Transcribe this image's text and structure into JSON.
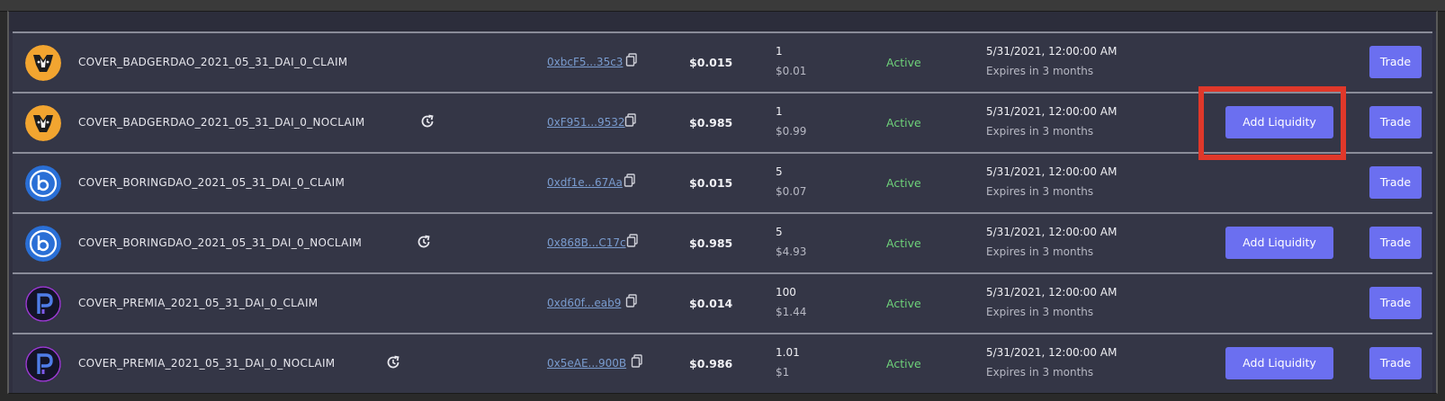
{
  "colors": {
    "accent_button": "#6b6ff0",
    "status_active": "#6ed17a",
    "highlight_box": "#e0382a",
    "row_bg": "#343646"
  },
  "rows": [
    {
      "logo": "badger-logo",
      "name": "COVER_BADGERDAO_2021_05_31_DAI_0_CLAIM",
      "has_refresh_icon": false,
      "address": "0xbcF5...35c3",
      "price": "$0.015",
      "balance": "1",
      "balance_usd": "$0.01",
      "status": "Active",
      "date": "5/31/2021, 12:00:00 AM",
      "expires": "Expires in 3 months",
      "add_liquidity": null,
      "trade": "Trade"
    },
    {
      "logo": "badger-logo",
      "name": "COVER_BADGERDAO_2021_05_31_DAI_0_NOCLAIM",
      "has_refresh_icon": true,
      "address": "0xF951...9532",
      "price": "$0.985",
      "balance": "1",
      "balance_usd": "$0.99",
      "status": "Active",
      "date": "5/31/2021, 12:00:00 AM",
      "expires": "Expires in 3 months",
      "add_liquidity": "Add Liquidity",
      "trade": "Trade"
    },
    {
      "logo": "boring-logo",
      "name": "COVER_BORINGDAO_2021_05_31_DAI_0_CLAIM",
      "has_refresh_icon": false,
      "address": "0xdf1e...67Aa",
      "price": "$0.015",
      "balance": "5",
      "balance_usd": "$0.07",
      "status": "Active",
      "date": "5/31/2021, 12:00:00 AM",
      "expires": "Expires in 3 months",
      "add_liquidity": null,
      "trade": "Trade"
    },
    {
      "logo": "boring-logo",
      "name": "COVER_BORINGDAO_2021_05_31_DAI_0_NOCLAIM",
      "has_refresh_icon": true,
      "address": "0x868B...C17c",
      "price": "$0.985",
      "balance": "5",
      "balance_usd": "$4.93",
      "status": "Active",
      "date": "5/31/2021, 12:00:00 AM",
      "expires": "Expires in 3 months",
      "add_liquidity": "Add Liquidity",
      "trade": "Trade"
    },
    {
      "logo": "premia-logo",
      "name": "COVER_PREMIA_2021_05_31_DAI_0_CLAIM",
      "has_refresh_icon": false,
      "address": "0xd60f...eab9",
      "price": "$0.014",
      "balance": "100",
      "balance_usd": "$1.44",
      "status": "Active",
      "date": "5/31/2021, 12:00:00 AM",
      "expires": "Expires in 3 months",
      "add_liquidity": null,
      "trade": "Trade"
    },
    {
      "logo": "premia-logo",
      "name": "COVER_PREMIA_2021_05_31_DAI_0_NOCLAIM",
      "has_refresh_icon": true,
      "address": "0x5eAE...900B",
      "price": "$0.986",
      "balance": "1.01",
      "balance_usd": "$1",
      "status": "Active",
      "date": "5/31/2021, 12:00:00 AM",
      "expires": "Expires in 3 months",
      "add_liquidity": "Add Liquidity",
      "trade": "Trade"
    }
  ]
}
